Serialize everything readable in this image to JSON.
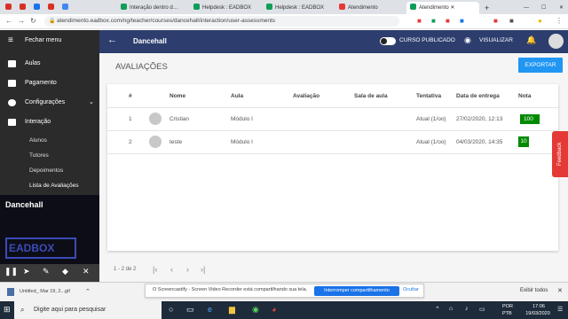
{
  "browser": {
    "tabs": [
      {
        "label": "",
        "color": "#d93025"
      },
      {
        "label": "",
        "color": "#d93025"
      },
      {
        "label": "",
        "color": "#1a73e8"
      },
      {
        "label": "",
        "color": "#d93025"
      },
      {
        "label": "",
        "color": "#4285f4"
      },
      {
        "label": "Interação dentro d…",
        "color": "#0f9d58"
      },
      {
        "label": "Helpdesk : EADBOX",
        "color": "#0f9d58"
      },
      {
        "label": "Helpdesk : EADBOX",
        "color": "#0f9d58"
      },
      {
        "label": "Atendimento",
        "color": "#e53935"
      },
      {
        "label": "Atendimento",
        "color": "#0f9d58"
      }
    ],
    "url": "atendimento.eadbox.com/ng/teacher/courses/dancehall/interaction/user-assessments"
  },
  "sidebar": {
    "close_menu": "Fechar menu",
    "items": [
      {
        "label": "Aulas"
      },
      {
        "label": "Pagamento"
      },
      {
        "label": "Configurações"
      },
      {
        "label": "Interação"
      }
    ],
    "subitems": [
      "Alunos",
      "Tutores",
      "Depoimentos",
      "Lista de Avaliações"
    ],
    "course_name": "Dancehall",
    "logo_text": "EADBOX"
  },
  "header": {
    "course_title": "Dancehall",
    "published_label": "CURSO PUBLICADO",
    "view_label": "VISUALIZAR"
  },
  "page": {
    "title": "AVALIAÇÕES",
    "export_label": "EXPORTAR"
  },
  "table": {
    "columns": [
      "#",
      "Nome",
      "Aula",
      "Avaliação",
      "Sala de aula",
      "Tentativa",
      "Data de entrega",
      "Nota"
    ],
    "rows": [
      {
        "num": "1",
        "name": "Cristian",
        "aula": "Módulo I",
        "tentativa": "Atual (1/oo)",
        "data": "27/02/2020, 12:13",
        "nota": "100"
      },
      {
        "num": "2",
        "name": "teste",
        "aula": "Módulo I",
        "tentativa": "Atual (1/oo)",
        "data": "04/03/2020, 14:35",
        "nota": "10"
      }
    ]
  },
  "pagination": {
    "range": "1 - 2 de 2"
  },
  "feedback_label": "Feedback",
  "download": {
    "filename": "Untitled_ Mar 19, 2...gif"
  },
  "share_notice": {
    "text": "O Screencastify - Screen Video Recorder está compartilhando sua tela.",
    "stop_label": "Interromper compartilhamento",
    "hide_label": "Ocultar"
  },
  "show_all": "Exibir todos",
  "taskbar": {
    "search_placeholder": "Digite aqui para pesquisar",
    "lang": "POR",
    "kbd": "PTB",
    "time": "17:06",
    "date": "19/03/2020"
  },
  "colors": {
    "header": "#2d3e6e",
    "accent": "#2196f3",
    "grade": "#008a00",
    "sidebar": "#2b2b2b"
  }
}
